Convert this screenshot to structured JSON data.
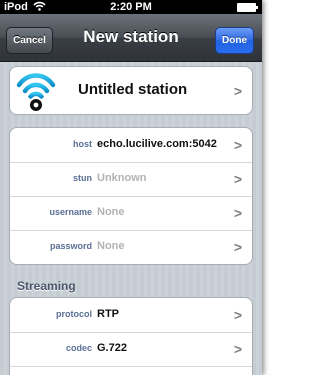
{
  "status_bar": {
    "carrier": "iPod",
    "time": "2:20 PM"
  },
  "nav": {
    "cancel_label": "Cancel",
    "title": "New station",
    "done_label": "Done"
  },
  "station": {
    "name": "Untitled station"
  },
  "details": [
    {
      "label": "host",
      "value": "echo.lucilive.com:5042",
      "placeholder": false
    },
    {
      "label": "stun",
      "value": "Unknown",
      "placeholder": true
    },
    {
      "label": "username",
      "value": "None",
      "placeholder": true
    },
    {
      "label": "password",
      "value": "None",
      "placeholder": true
    }
  ],
  "streaming": {
    "header": "Streaming",
    "rows": [
      {
        "label": "protocol",
        "value": "RTP"
      },
      {
        "label": "codec",
        "value": "G.722"
      }
    ]
  },
  "colors": {
    "done_button": "#2a6df1",
    "label_text": "#5a6f94",
    "placeholder_text": "#b3b3b3",
    "section_header": "#4c566c"
  },
  "icons": [
    "wifi-icon",
    "battery-icon",
    "station-wifi-icon",
    "chevron-right-icon"
  ]
}
